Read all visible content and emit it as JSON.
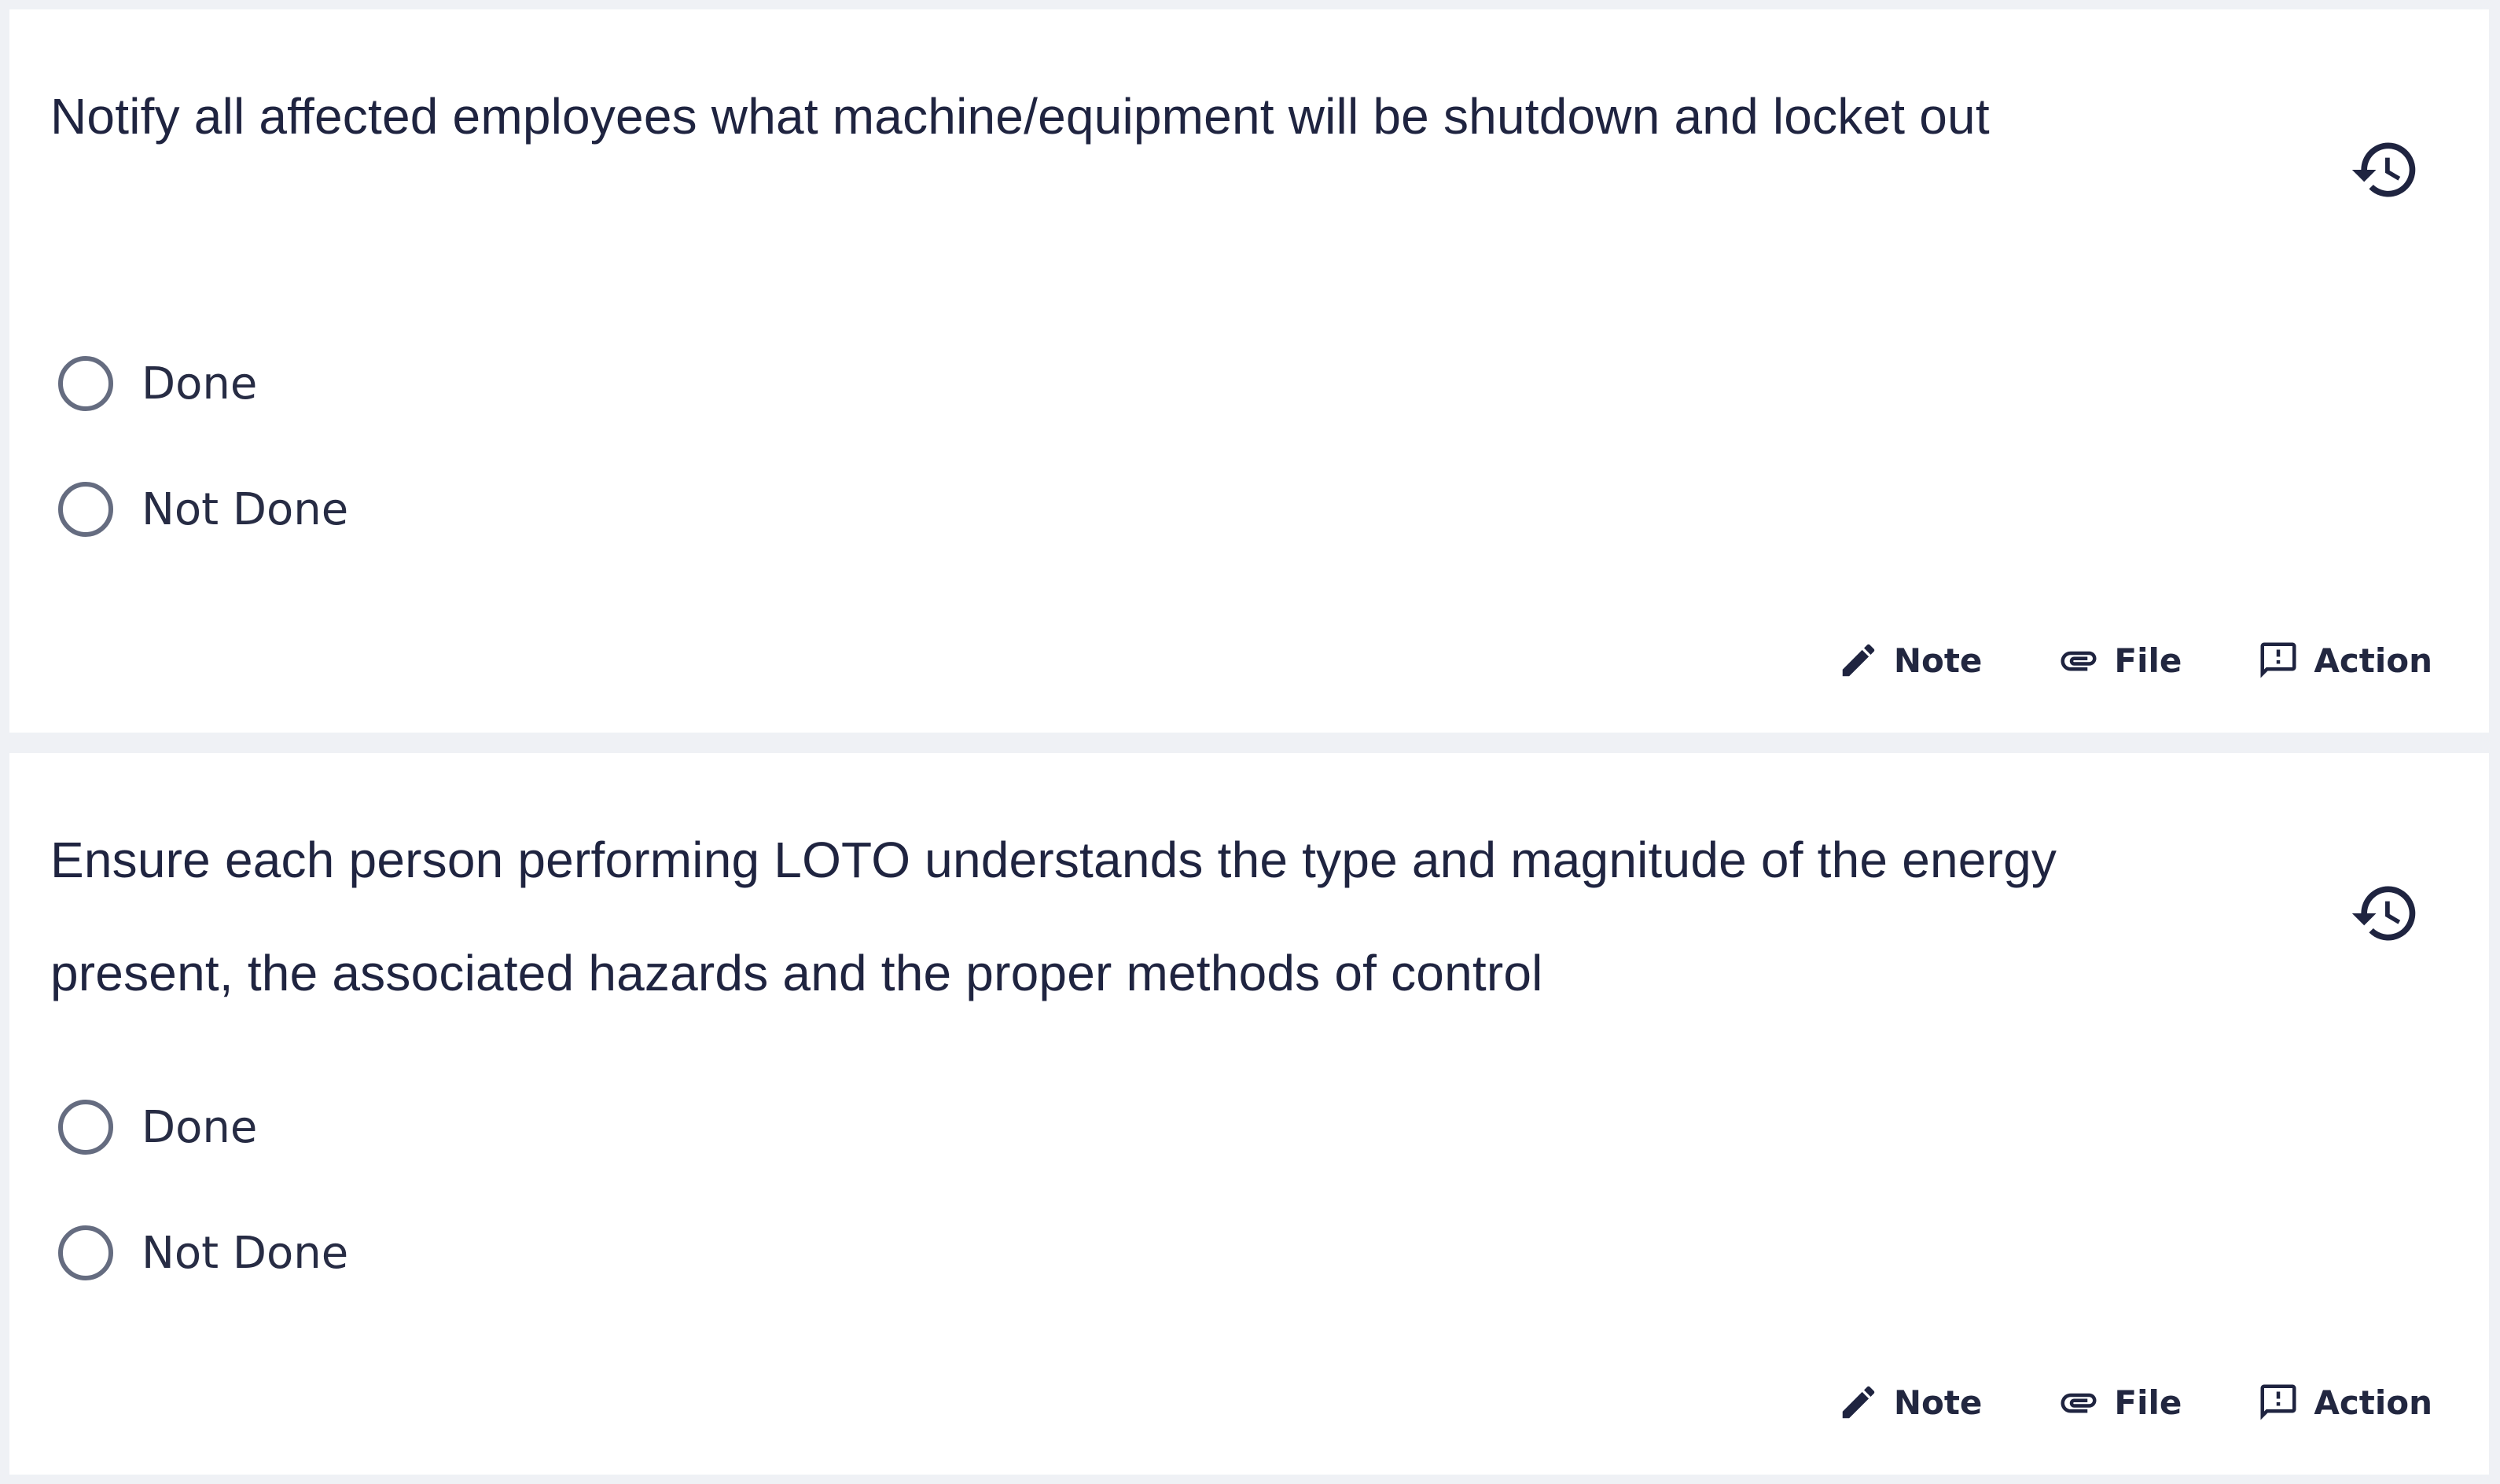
{
  "checklist": {
    "items": [
      {
        "question": "Notify all affected employees what machine/equipment will be shutdown and locket out",
        "options": [
          {
            "label": "Done",
            "selected": false
          },
          {
            "label": "Not Done",
            "selected": false
          }
        ],
        "actions": {
          "note_label": "Note",
          "file_label": "File",
          "action_label": "Action"
        },
        "history_icon": "history-icon"
      },
      {
        "question": "Ensure each person performing LOTO understands the type and magnitude of the energy present, the associated hazards and the proper methods of control",
        "options": [
          {
            "label": "Done",
            "selected": false
          },
          {
            "label": "Not Done",
            "selected": false
          }
        ],
        "actions": {
          "note_label": "Note",
          "file_label": "File",
          "action_label": "Action"
        },
        "history_icon": "history-icon"
      }
    ]
  },
  "colors": {
    "background": "#eff1f5",
    "card": "#ffffff",
    "text": "#1f2440",
    "radio_border": "#656c80"
  }
}
